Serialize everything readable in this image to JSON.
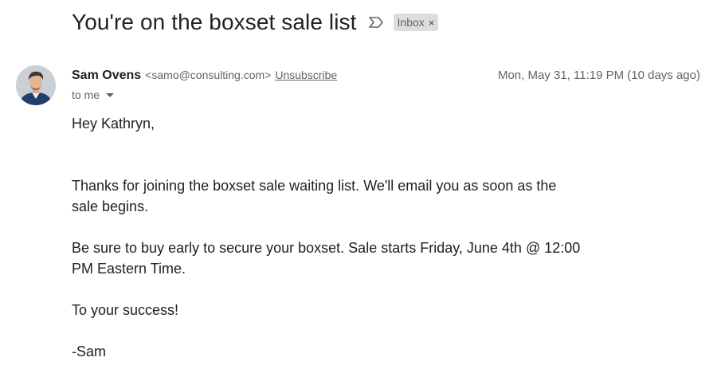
{
  "email": {
    "subject": "You're on the boxset sale list",
    "label_chip": "Inbox",
    "label_close": "×",
    "sender_name": "Sam Ovens",
    "sender_email": "<samo@consulting.com>",
    "unsubscribe": "Unsubscribe",
    "date": "Mon, May 31, 11:19 PM (10 days ago)",
    "recipient": "to me",
    "body": {
      "greeting": "Hey Kathryn,",
      "para1": "Thanks for joining the boxset sale waiting list. We'll email you as soon as the sale begins.",
      "para2": "Be sure to buy early to secure your boxset. Sale starts Friday, June 4th @ 12:00 PM Eastern Time.",
      "para3": "To your success!",
      "signature": "-Sam"
    }
  },
  "icons": {
    "important_marker": "importance-marker-icon",
    "avatar": "sender-avatar",
    "recipient_dropdown": "chevron-down-icon"
  },
  "colors": {
    "text_primary": "#202124",
    "text_secondary": "#5f6368",
    "chip_bg": "#dddddd"
  }
}
